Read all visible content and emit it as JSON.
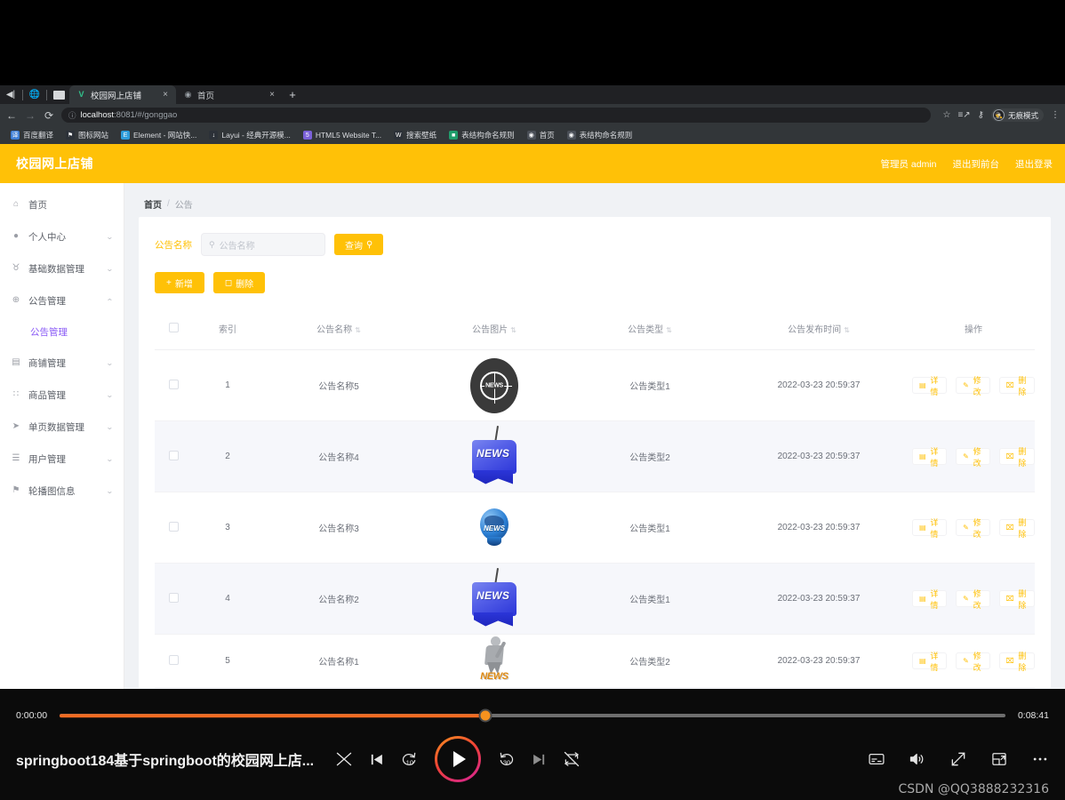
{
  "browser": {
    "window_controls": [
      "back-arrow",
      "globe",
      "window-square"
    ],
    "tabs": [
      {
        "title": "校园网上店铺",
        "favicon": "V",
        "active": true,
        "close": "×"
      },
      {
        "title": "首页",
        "favicon": "globe",
        "active": false,
        "close": "×"
      }
    ],
    "new_tab": "+",
    "nav": {
      "back": "←",
      "forward": "→",
      "reload": "⟳"
    },
    "omnibox": {
      "info_icon": "ⓘ",
      "url_host": "localhost",
      "url_rest": ":8081/#/gonggao"
    },
    "toolbar_icons": [
      "star-icon",
      "reading-list-icon",
      "key-icon",
      "menu-icon"
    ],
    "incognito_label": "无痕模式",
    "bookmarks": [
      {
        "label": "百度翻译",
        "color": "#3f7fd6",
        "glyph": "译"
      },
      {
        "label": "图标网站",
        "color": "#2c3138",
        "glyph": "⚑"
      },
      {
        "label": "Element - 网站快...",
        "color": "#2d9cdb",
        "glyph": "E"
      },
      {
        "label": "Layui - 经典开源模...",
        "color": "#2c3138",
        "glyph": "↓"
      },
      {
        "label": "HTML5 Website T...",
        "color": "#7b61d9",
        "glyph": "5"
      },
      {
        "label": "搜索壁纸",
        "color": "#2c3138",
        "glyph": "W"
      },
      {
        "label": "表结构命名规则",
        "color": "#1f9d6b",
        "glyph": "■"
      },
      {
        "label": "首页",
        "color": "#4a4f57",
        "glyph": "◉"
      },
      {
        "label": "表结构命名规则",
        "color": "#4a4f57",
        "glyph": "◉"
      }
    ]
  },
  "app": {
    "title": "校园网上店铺",
    "header_right": [
      "管理员 admin",
      "退出到前台",
      "退出登录"
    ],
    "accent_color": "#ffc107",
    "active_menu_color": "#8b5cf6",
    "sidebar": [
      {
        "label": "首页",
        "icon": "home-icon",
        "glyph": "⌂",
        "expandable": false
      },
      {
        "label": "个人中心",
        "icon": "user-icon",
        "glyph": "●",
        "expandable": true,
        "expanded": false
      },
      {
        "label": "基础数据管理",
        "icon": "mic-icon",
        "glyph": "♉",
        "expandable": true,
        "expanded": false
      },
      {
        "label": "公告管理",
        "icon": "clock-icon",
        "glyph": "⊕",
        "expandable": true,
        "expanded": true
      },
      {
        "label": "商铺管理",
        "icon": "store-icon",
        "glyph": "▤",
        "expandable": true,
        "expanded": false
      },
      {
        "label": "商品管理",
        "icon": "grid-icon",
        "glyph": "∷",
        "expandable": true,
        "expanded": false
      },
      {
        "label": "单页数据管理",
        "icon": "send-icon",
        "glyph": "➤",
        "expandable": true,
        "expanded": false
      },
      {
        "label": "用户管理",
        "icon": "users-icon",
        "glyph": "☰",
        "expandable": true,
        "expanded": false
      },
      {
        "label": "轮播图信息",
        "icon": "pin-icon",
        "glyph": "⚑",
        "expandable": true,
        "expanded": false
      }
    ],
    "sidebar_submenu": {
      "parent_index": 3,
      "label": "公告管理",
      "active": true
    },
    "breadcrumb": {
      "home": "首页",
      "separator": "/",
      "current": "公告"
    },
    "search": {
      "label": "公告名称",
      "placeholder": "公告名称",
      "value": "",
      "button_label": "查询",
      "button_icon": "search-icon"
    },
    "actions": [
      {
        "label": "新增",
        "icon": "plus-icon",
        "glyph": "+"
      },
      {
        "label": "删除",
        "icon": "trash-icon",
        "glyph": "Ὕ1"
      }
    ],
    "table": {
      "columns": [
        {
          "key": "checkbox",
          "label": "",
          "sortable": false
        },
        {
          "key": "index",
          "label": "索引",
          "sortable": false
        },
        {
          "key": "name",
          "label": "公告名称",
          "sortable": true
        },
        {
          "key": "image",
          "label": "公告图片",
          "sortable": true
        },
        {
          "key": "type",
          "label": "公告类型",
          "sortable": true
        },
        {
          "key": "time",
          "label": "公告发布时间",
          "sortable": true
        },
        {
          "key": "ops",
          "label": "操作",
          "sortable": false
        }
      ],
      "sort_glyph": "⇅",
      "rows": [
        {
          "index": "1",
          "name": "公告名称5",
          "image": "news-dark-globe",
          "type": "公告类型1",
          "time": "2022-03-23 20:59:37"
        },
        {
          "index": "2",
          "name": "公告名称4",
          "image": "news-blue-flag",
          "type": "公告类型2",
          "time": "2022-03-23 20:59:37"
        },
        {
          "index": "3",
          "name": "公告名称3",
          "image": "news-blue-globe",
          "type": "公告类型1",
          "time": "2022-03-23 20:59:37"
        },
        {
          "index": "4",
          "name": "公告名称2",
          "image": "news-blue-flag",
          "type": "公告类型1",
          "time": "2022-03-23 20:59:37"
        },
        {
          "index": "5",
          "name": "公告名称1",
          "image": "news-reporter",
          "type": "公告类型2",
          "time": "2022-03-23 20:59:37"
        }
      ],
      "row_ops": [
        {
          "label": "详情",
          "icon": "detail-icon",
          "glyph": "▤"
        },
        {
          "label": "修改",
          "icon": "edit-icon",
          "glyph": "✎"
        },
        {
          "label": "删除",
          "icon": "trash-icon",
          "glyph": "Ὕ1"
        }
      ]
    }
  },
  "player": {
    "current_time": "0:00:00",
    "total_time": "0:08:41",
    "progress_percent": 45,
    "title": "springboot184基于springboot的校园网上店...",
    "controls_left": [
      {
        "name": "shuffle-icon",
        "glyph": "⤨"
      },
      {
        "name": "previous-icon",
        "glyph": "⏮"
      },
      {
        "name": "rewind-10-icon",
        "glyph": "10"
      },
      {
        "name": "play-icon",
        "glyph": "▶"
      },
      {
        "name": "forward-30-icon",
        "glyph": "30"
      },
      {
        "name": "next-icon",
        "glyph": "⏭"
      },
      {
        "name": "repeat-off-icon",
        "glyph": "↻"
      }
    ],
    "controls_right": [
      {
        "name": "subtitles-icon",
        "glyph": "▤"
      },
      {
        "name": "volume-icon",
        "glyph": "🔊"
      },
      {
        "name": "fullscreen-icon",
        "glyph": "↗"
      },
      {
        "name": "picture-in-picture-icon",
        "glyph": "⧉"
      },
      {
        "name": "more-options-icon",
        "glyph": "⋯"
      }
    ],
    "watermark": "CSDN @QQ3888232316"
  }
}
